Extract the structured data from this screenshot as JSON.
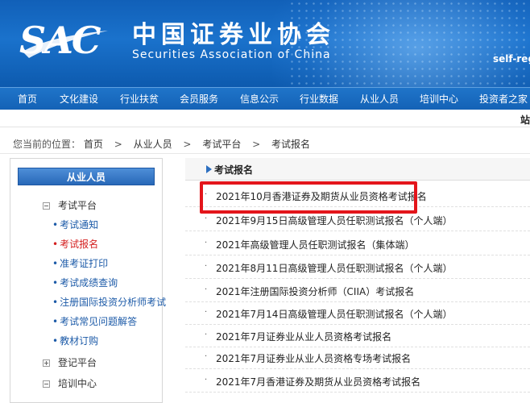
{
  "header": {
    "logo_text": "SAC",
    "cn_name": "中国证券业协会",
    "en_name": "Securities Association of China",
    "self_reg": "self-reg"
  },
  "nav": {
    "items": [
      "首页",
      "文化建设",
      "行业扶贫",
      "会员服务",
      "信息公示",
      "行业数据",
      "从业人员",
      "培训中心",
      "投资者之家"
    ]
  },
  "subbar": {
    "right_text": "站"
  },
  "breadcrumb": {
    "prefix": "您当前的位置：",
    "items": [
      "首页",
      "从业人员",
      "考试平台",
      "考试报名"
    ],
    "separator": ">"
  },
  "sidebar": {
    "title": "从业人员",
    "groups": [
      {
        "label": "考试平台",
        "expanded": true
      },
      {
        "label": "登记平台",
        "expanded": false
      },
      {
        "label": "培训中心",
        "expanded": true
      }
    ],
    "links": [
      {
        "label": "考试通知",
        "active": false
      },
      {
        "label": "考试报名",
        "active": true
      },
      {
        "label": "准考证打印",
        "active": false
      },
      {
        "label": "考试成绩查询",
        "active": false
      },
      {
        "label": "注册国际投资分析师考试",
        "active": false
      },
      {
        "label": "考试常见问题解答",
        "active": false
      },
      {
        "label": "教材订购",
        "active": false
      }
    ],
    "bullet": "•"
  },
  "main": {
    "title": "考试报名",
    "bullet": "·",
    "items": [
      "2021年10月香港证券及期货从业员资格考试报名",
      "2021年9月15日高级管理人员任职测试报名（个人端）",
      "2021年高级管理人员任职测试报名（集体端）",
      "2021年8月11日高级管理人员任职测试报名（个人端）",
      "2021年注册国际投资分析师（CIIA）考试报名",
      "2021年7月14日高级管理人员任职测试报名（个人端）",
      "2021年7月证券业从业人员资格考试报名",
      "2021年7月证券业从业人员资格专场考试报名",
      "2021年7月香港证券及期货从业员资格考试报名"
    ]
  },
  "colors": {
    "brand_blue": "#1a6cc4",
    "link_blue": "#1d5ba8",
    "active_red": "#d42020",
    "highlight_red": "#e3151b"
  }
}
